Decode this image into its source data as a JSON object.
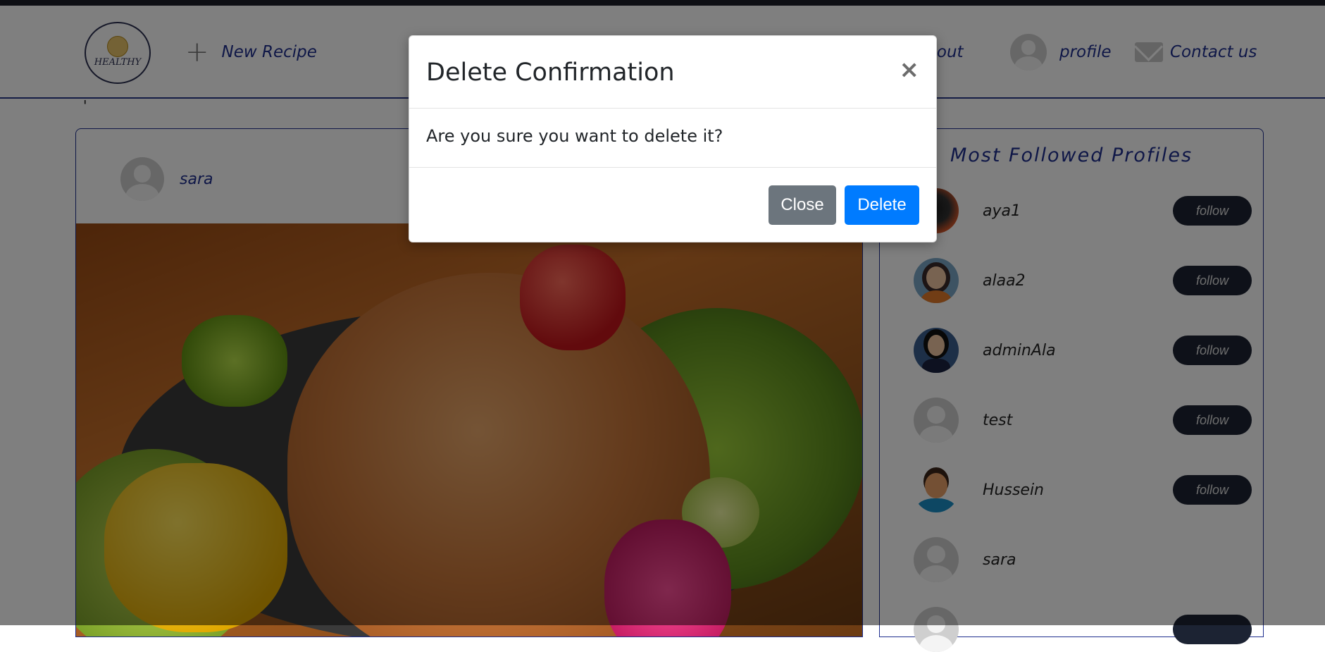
{
  "navbar": {
    "logo_text": "HEALTHY",
    "new_recipe_label": "New Recipe",
    "sign_out_label": "n out",
    "profile_label": "profile",
    "contact_label": "Contact us"
  },
  "post": {
    "username": "sara",
    "image_alt": "roast chicken with vegetables"
  },
  "sidebar": {
    "title": "Most Followed Profiles",
    "profiles": [
      {
        "name": "aya1",
        "button": "follow",
        "avatar": "photo"
      },
      {
        "name": "alaa2",
        "button": "follow",
        "avatar": "illustration-hijab"
      },
      {
        "name": "adminAla",
        "button": "follow",
        "avatar": "illustration-dark-hair"
      },
      {
        "name": "test",
        "button": "follow",
        "avatar": "default"
      },
      {
        "name": "Hussein",
        "button": "follow",
        "avatar": "illustration-man"
      },
      {
        "name": "sara",
        "button": "",
        "avatar": "default"
      }
    ]
  },
  "modal": {
    "title": "Delete Confirmation",
    "close_glyph": "×",
    "body": "Are you sure you want to delete it?",
    "close_button": "Close",
    "delete_button": "Delete"
  },
  "colors": {
    "accent": "#1f2f8f",
    "primary_button": "#007bff",
    "secondary_button": "#6c757d",
    "follow_button": "#1c2333"
  }
}
